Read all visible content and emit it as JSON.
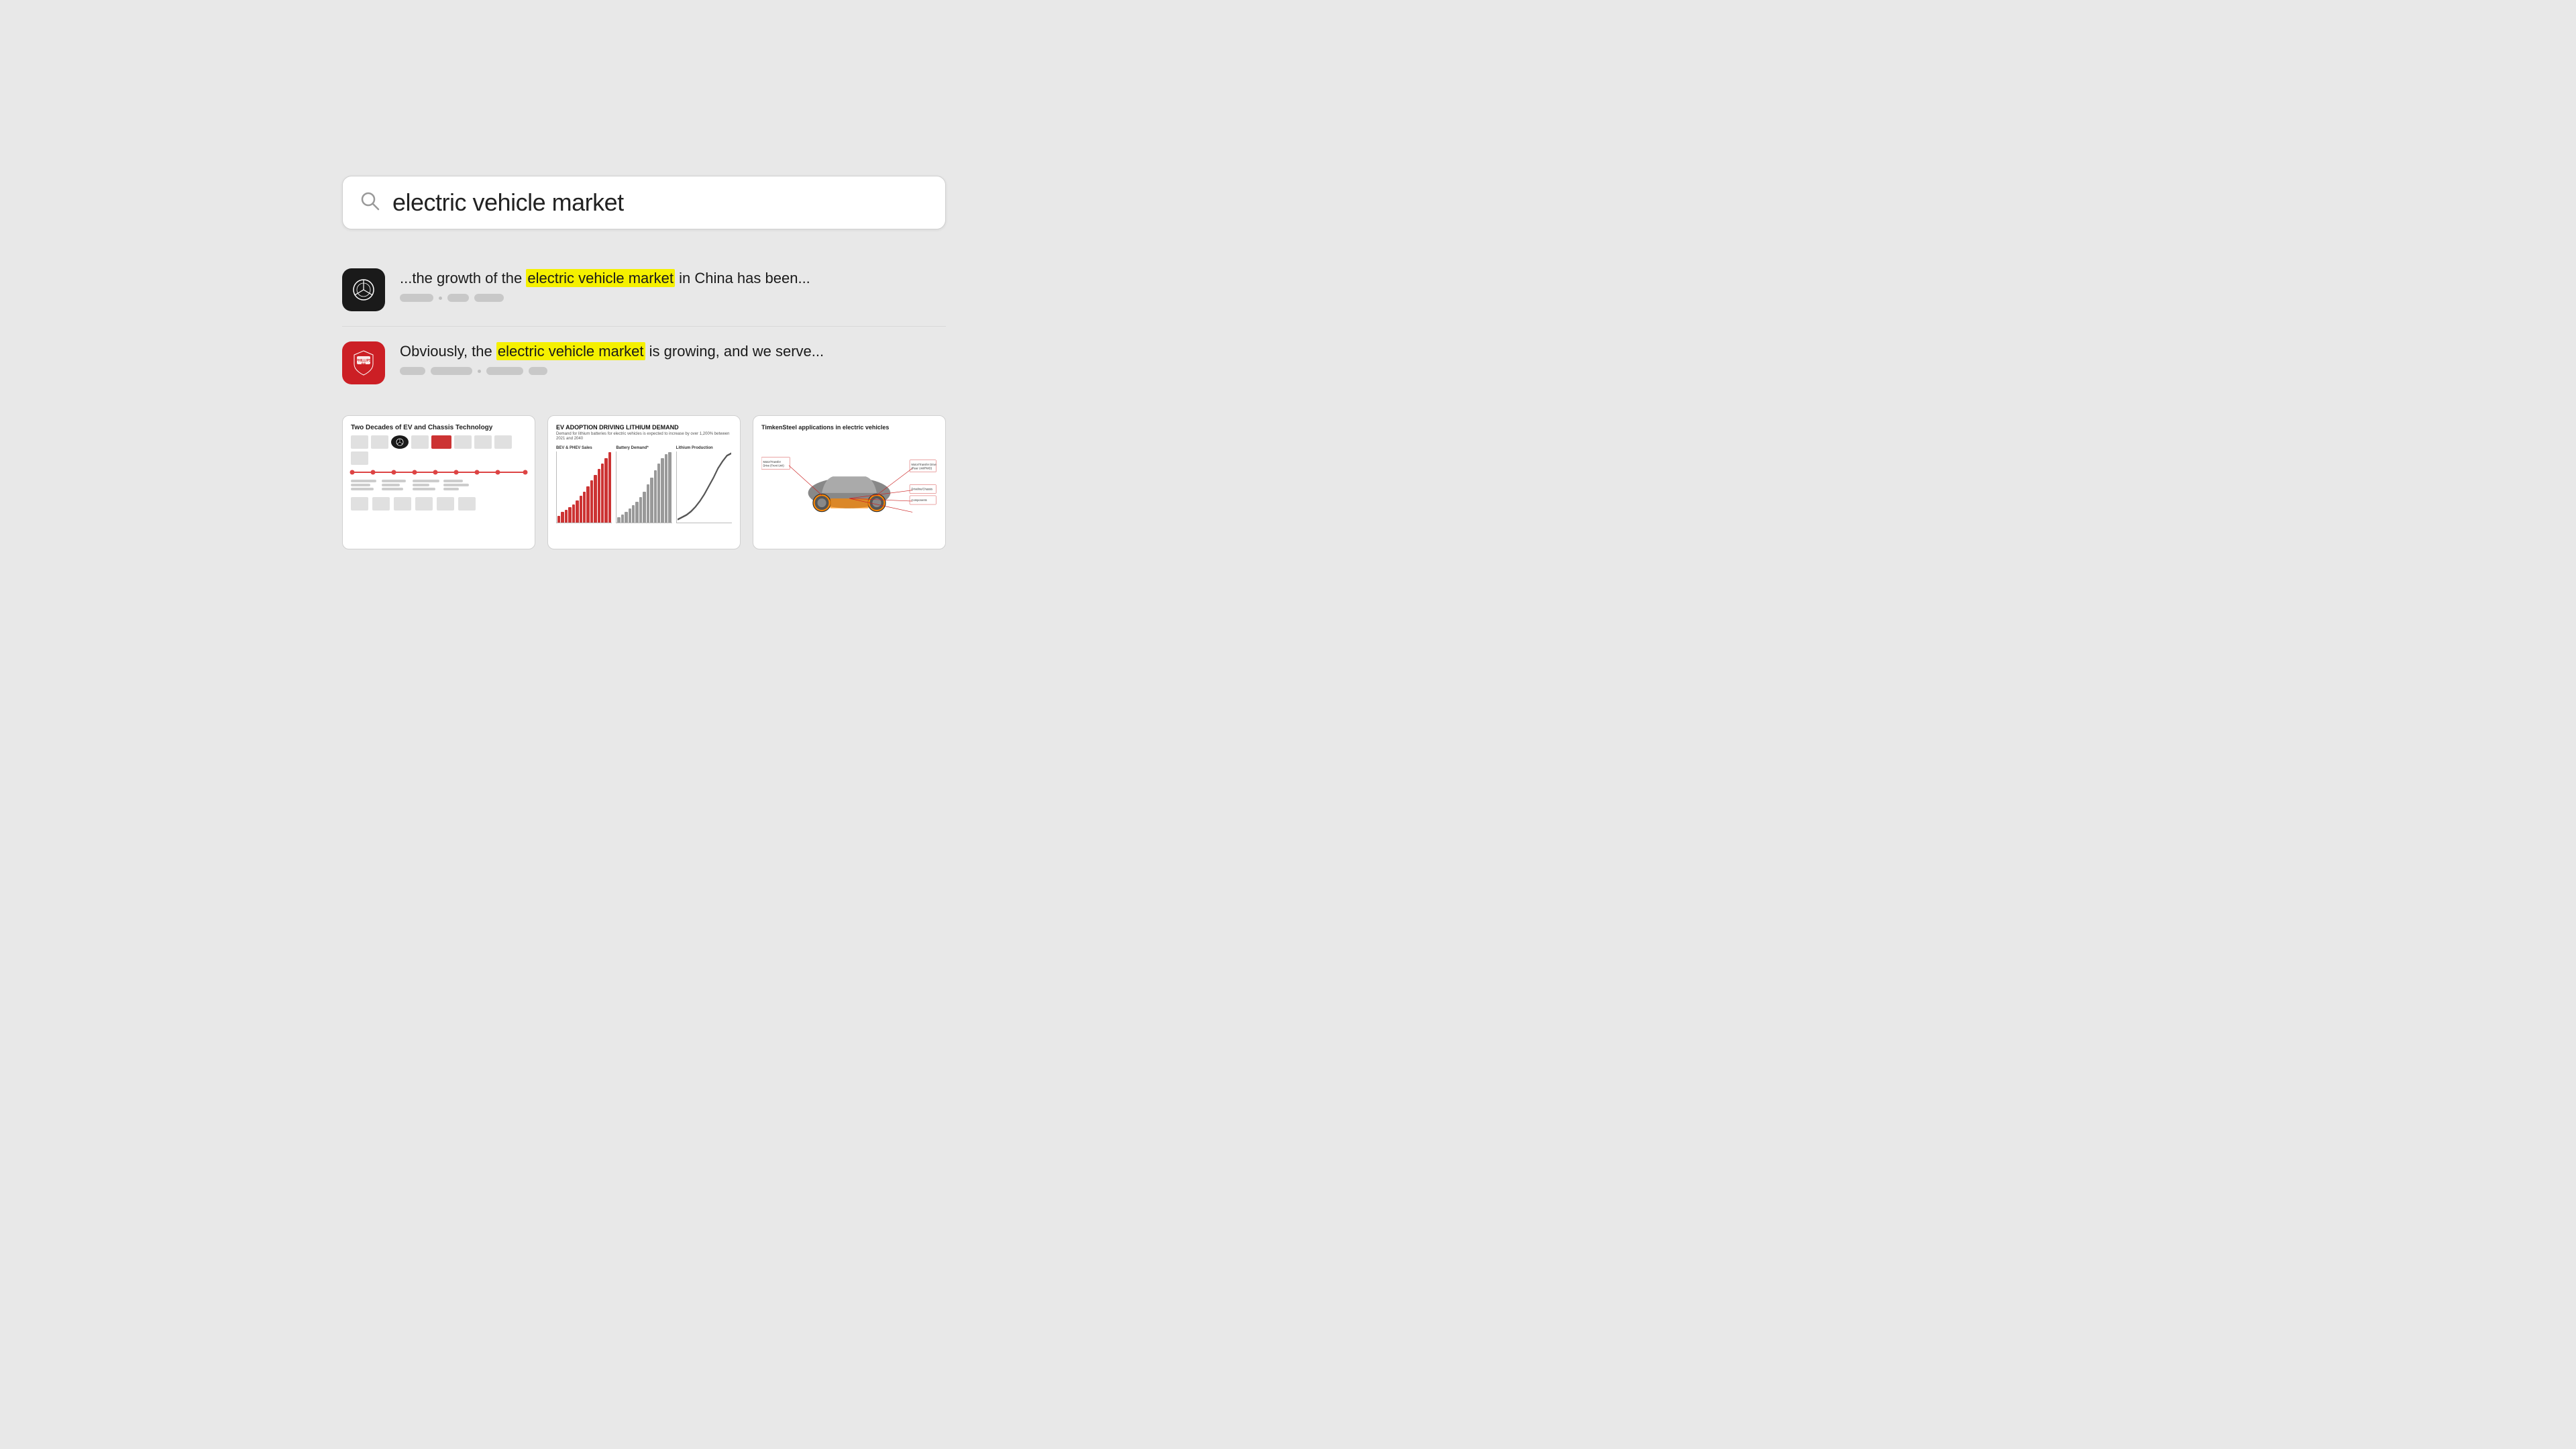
{
  "search": {
    "placeholder": "electric vehicle market",
    "query": "electric vehicle market"
  },
  "results": [
    {
      "id": "result-1",
      "logo": "mercedes",
      "text_before": "...the growth of the ",
      "highlight": "electric vehicle market",
      "text_after": " in China has been...",
      "meta": [
        {
          "type": "pill",
          "width": 60
        },
        {
          "type": "dot"
        },
        {
          "type": "pill",
          "width": 36
        },
        {
          "type": "pill",
          "width": 50
        }
      ]
    },
    {
      "id": "result-2",
      "logo": "phillips",
      "text_before": "Obviously, the ",
      "highlight": "electric vehicle market",
      "text_after": " is growing, and we serve...",
      "meta": [
        {
          "type": "pill",
          "width": 44
        },
        {
          "type": "pill",
          "width": 70
        },
        {
          "type": "dot"
        },
        {
          "type": "pill",
          "width": 60
        },
        {
          "type": "pill",
          "width": 30
        }
      ]
    }
  ],
  "thumbnails": [
    {
      "id": "thumb-1",
      "title": "Two Decades of EV and Chassis Technology",
      "subtitle": ""
    },
    {
      "id": "thumb-2",
      "title": "EV ADOPTION DRIVING LITHIUM DEMAND",
      "subtitle": "Demand for lithium batteries for electric vehicles is expected to increase by over 1,200% between 2021 and 2040"
    },
    {
      "id": "thumb-3",
      "title": "TimkenSteel applications in electric vehicles",
      "subtitle": ""
    }
  ],
  "icons": {
    "search": "⌕",
    "mercedes_alt": "Mercedes-Benz star",
    "phillips_alt": "Phillips 66 shield"
  }
}
